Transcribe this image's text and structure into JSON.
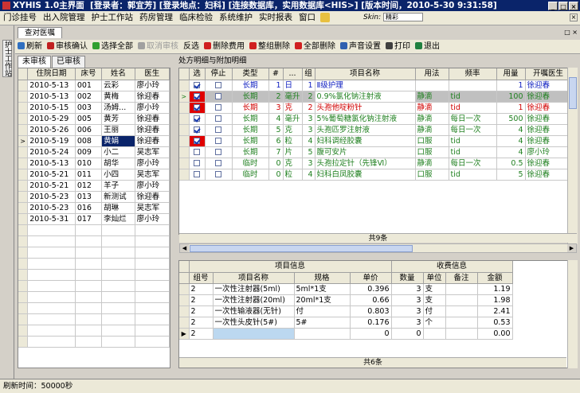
{
  "title": {
    "app": "XYHIS 1.0主界面",
    "user": "[登录者：郭宜芳]",
    "location": "[登录地点：妇科]",
    "db": "[连接数据库，实用数据库<HIS>]",
    "version": "[版本时间，2010-5-30 9:31:58]"
  },
  "menu": [
    "门诊挂号",
    "出入院管理",
    "护士工作站",
    "药房管理",
    "临床检验",
    "系统维护",
    "实时报表",
    "窗口"
  ],
  "skin": {
    "label": "Skin:",
    "value": "精彩"
  },
  "left_strip_label": "护士工作站",
  "doc_tab": "查对医嘱",
  "toolbar": [
    {
      "label": "刷新",
      "icon": "refresh-icon",
      "color": "#3070c0",
      "enabled": true
    },
    {
      "label": "审核确认",
      "icon": "check-icon",
      "color": "#c02020",
      "enabled": true
    },
    {
      "label": "选择全部",
      "icon": "select-all-icon",
      "color": "#30a030",
      "enabled": true
    },
    {
      "label": "取消审核",
      "icon": "cancel-review-icon",
      "color": "#a0a0a0",
      "enabled": false
    },
    {
      "label": "反选",
      "icon": "",
      "color": "",
      "enabled": true
    },
    {
      "label": "删除费用",
      "icon": "delete-icon",
      "color": "#d02020",
      "enabled": true
    },
    {
      "label": "整组删除",
      "icon": "delete-group-icon",
      "color": "#d02020",
      "enabled": true
    },
    {
      "label": "全部删除",
      "icon": "delete-all-icon",
      "color": "#d02020",
      "enabled": true
    },
    {
      "label": "声音设置",
      "icon": "sound-icon",
      "color": "#3060b0",
      "enabled": true
    },
    {
      "label": "打印",
      "icon": "print-icon",
      "color": "#404040",
      "enabled": true
    },
    {
      "label": "退出",
      "icon": "exit-icon",
      "color": "#208040",
      "enabled": true
    }
  ],
  "left_tabs": [
    "未审核",
    "已审核"
  ],
  "patients": {
    "columns": [
      "住院日期",
      "床号",
      "姓名",
      "医生"
    ],
    "selected_index": 5,
    "rows": [
      [
        "2010-5-13",
        "001",
        "云彩",
        "廖小玲"
      ],
      [
        "2010-5-13",
        "002",
        "黄梅",
        "徐迎春"
      ],
      [
        "2010-5-15",
        "003",
        "汤姆...",
        "廖小玲"
      ],
      [
        "2010-5-29",
        "005",
        "黄芳",
        "徐迎春"
      ],
      [
        "2010-5-26",
        "006",
        "王丽",
        "徐迎春"
      ],
      [
        "2010-5-19",
        "008",
        "黄娟",
        "徐迎春"
      ],
      [
        "2010-5-24",
        "009",
        "小二",
        "吴志军"
      ],
      [
        "2010-5-13",
        "010",
        "胡华",
        "廖小玲"
      ],
      [
        "2010-5-21",
        "011",
        "小四",
        "吴志军"
      ],
      [
        "2010-5-21",
        "012",
        "羊子",
        "廖小玲"
      ],
      [
        "2010-5-23",
        "013",
        "新测试",
        "徐迎春"
      ],
      [
        "2010-5-23",
        "016",
        "胡琳",
        "吴志军"
      ],
      [
        "2010-5-31",
        "017",
        "李灿烂",
        "廖小玲"
      ]
    ]
  },
  "orders_label": "处方明细与附加明细",
  "orders": {
    "columns": [
      "选",
      "停止",
      "类型",
      "#",
      "...",
      "组",
      "项目名称",
      "用法",
      "频率",
      "用量",
      "开嘱医生"
    ],
    "footer": "共9条",
    "selected_index": 1,
    "rows": [
      {
        "type": "长期",
        "num": "1",
        "unit": "日",
        "grp": "1",
        "name": "Ⅱ级护理",
        "usage": "",
        "freq": "",
        "qty": "1",
        "doctor": "徐迎春",
        "color": "blue",
        "red": false,
        "checked": true
      },
      {
        "type": "长期",
        "num": "2",
        "unit": "毫升",
        "grp": "2",
        "name": "0.9%氯化钠注射液",
        "usage": "静滴",
        "freq": "tid",
        "qty": "100",
        "doctor": "徐迎春",
        "color": "green",
        "red": true,
        "checked": true
      },
      {
        "type": "长期",
        "num": "3",
        "unit": "克",
        "grp": "2",
        "name": "头孢他啶粉针",
        "usage": "静滴",
        "freq": "tid",
        "qty": "1",
        "doctor": "徐迎春",
        "color": "red",
        "red": true,
        "checked": true
      },
      {
        "type": "长期",
        "num": "4",
        "unit": "毫升",
        "grp": "3",
        "name": "5%葡萄糖氯化钠注射液",
        "usage": "静滴",
        "freq": "每日一次",
        "qty": "500",
        "doctor": "徐迎春",
        "color": "green",
        "red": false,
        "checked": true
      },
      {
        "type": "长期",
        "num": "5",
        "unit": "克",
        "grp": "3",
        "name": "头孢匹罗注射液",
        "usage": "静滴",
        "freq": "每日一次",
        "qty": "4",
        "doctor": "徐迎春",
        "color": "green",
        "red": false,
        "checked": true
      },
      {
        "type": "长期",
        "num": "6",
        "unit": "粒",
        "grp": "4",
        "name": "妇科调经胶囊",
        "usage": "口服",
        "freq": "tid",
        "qty": "4",
        "doctor": "徐迎春",
        "color": "green",
        "red": true,
        "checked": true
      },
      {
        "type": "长期",
        "num": "7",
        "unit": "片",
        "grp": "5",
        "name": "腹可安片",
        "usage": "口服",
        "freq": "tid",
        "qty": "4",
        "doctor": "廖小玲",
        "color": "green",
        "red": false,
        "checked": false
      },
      {
        "type": "临时",
        "num": "0",
        "unit": "克",
        "grp": "3",
        "name": "头孢拉定针（先锋Ⅵ）",
        "usage": "静滴",
        "freq": "每日一次",
        "qty": "0.5",
        "doctor": "徐迎春",
        "color": "green",
        "red": false,
        "checked": false
      },
      {
        "type": "临时",
        "num": "0",
        "unit": "粒",
        "grp": "4",
        "name": "妇科白凤胶囊",
        "usage": "口服",
        "freq": "tid",
        "qty": "5",
        "doctor": "徐迎春",
        "color": "green",
        "red": false,
        "checked": false
      }
    ]
  },
  "fees": {
    "band_left": "项目信息",
    "band_right": "收费信息",
    "columns": [
      "组号",
      "项目名称",
      "规格",
      "单价",
      "数量",
      "单位",
      "备注",
      "金额"
    ],
    "footer": "共6条",
    "rows": [
      [
        "2",
        "一次性注射器(5ml)",
        "5ml*1支",
        "0.396",
        "3",
        "支",
        "",
        "1.19"
      ],
      [
        "2",
        "一次性注射器(20ml)",
        "20ml*1支",
        "0.66",
        "3",
        "支",
        "",
        "1.98"
      ],
      [
        "2",
        "一次性输液器(无针)",
        "付",
        "0.803",
        "3",
        "付",
        "",
        "2.41"
      ],
      [
        "2",
        "一次性头皮针(5#)",
        "5#",
        "0.176",
        "3",
        "个",
        "",
        "0.53"
      ],
      [
        "2",
        "",
        "",
        "0",
        "0",
        "",
        "",
        "0.00"
      ]
    ]
  },
  "status": "刷新时间：50000秒"
}
